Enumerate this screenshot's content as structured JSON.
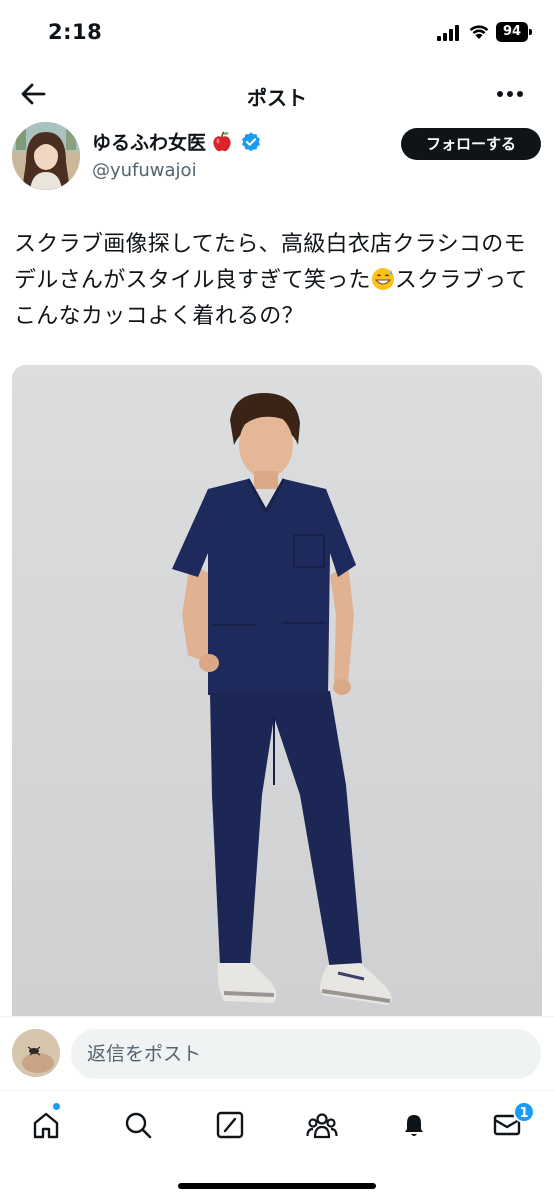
{
  "status_bar": {
    "time": "2:18",
    "battery": "94"
  },
  "header": {
    "title": "ポスト",
    "back_icon": "arrow-left-icon",
    "more_icon": "more-horizontal-icon"
  },
  "author": {
    "display_name": "ゆるふわ女医",
    "name_emoji": "red-apple-icon",
    "verified": true,
    "handle": "@yufuwajoi",
    "follow_label": "フォローする"
  },
  "tweet": {
    "text_before_emoji": "スクラブ画像探してたら、高級白衣店クラシコのモデルさんがスタイル良すぎて笑った",
    "emoji": "grinning-sweat-icon",
    "text_after_emoji": "スクラブってこんなカッコよく着れるの？"
  },
  "reply": {
    "placeholder": "返信をポスト"
  },
  "tab_bar": {
    "items": [
      "home-icon",
      "search-icon",
      "grok-icon",
      "communities-icon",
      "notifications-icon",
      "messages-icon"
    ],
    "messages_badge": "1"
  },
  "colors": {
    "accent": "#1d9bf0",
    "text": "#0f1419",
    "secondary": "#536471",
    "scrub_navy": "#1f2a5c",
    "photo_bg": "#d7d8da"
  }
}
